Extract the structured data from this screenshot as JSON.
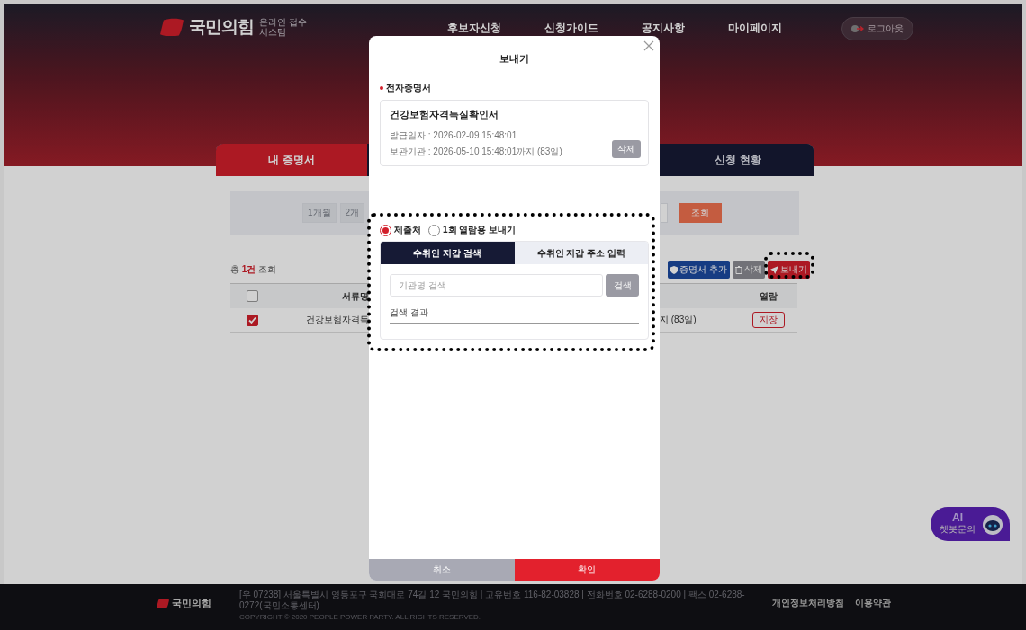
{
  "header": {
    "logo": "국민의힘",
    "logo_sub": [
      "온라인 접수",
      "시스템"
    ],
    "nav": [
      {
        "label": "후보자신청"
      },
      {
        "label": "신청가이드"
      },
      {
        "label": "공지사항"
      },
      {
        "label": "마이페이지"
      }
    ],
    "logout": "로그아웃"
  },
  "tabs": [
    {
      "label": "내 증명서",
      "selected": true
    },
    {
      "label": "신청 현황",
      "selected": false
    }
  ],
  "filter": {
    "periods": [
      "1개월",
      "2개"
    ],
    "search_button": "조회"
  },
  "summary": "총 **1건** 조회",
  "toolbar": [
    {
      "label": "증명서 추가",
      "kind": "add"
    },
    {
      "label": "삭제",
      "kind": "delete"
    },
    {
      "label": "보내기",
      "kind": "send"
    }
  ],
  "table": {
    "header_checked": false,
    "columns": [
      "서류명",
      "열람"
    ],
    "rows": [
      {
        "checked": true,
        "name": "건강보험자격득",
        "period": "지 (83일)",
        "action": "지장"
      }
    ]
  },
  "modal": {
    "title": "보내기",
    "section": "전자증명서",
    "certificate": {
      "name": "건강보험자격득실확인서",
      "issued": "발급일자 : 2026-02-09 15:48:01",
      "retention": "보관기관 : 2026-05-10 15:48:01까지 (83일)",
      "delete": "삭제"
    },
    "recipient_options": [
      {
        "label": "제출처",
        "selected": true
      },
      {
        "label": "1회 열람용 보내기",
        "selected": false
      }
    ],
    "recipient_tabs": [
      {
        "label": "수취인 지갑 검색",
        "selected": true
      },
      {
        "label": "수취인 지갑 주소 입력",
        "selected": false
      }
    ],
    "search": {
      "placeholder": "기관명 검색",
      "button": "검색"
    },
    "results_label": "검색 결과",
    "buttons": [
      {
        "label": "취소",
        "kind": "cancel"
      },
      {
        "label": "확인",
        "kind": "confirm"
      }
    ]
  },
  "chatbot": {
    "title": "AI",
    "label": "챗봇문의"
  },
  "footer": {
    "logo": "국민의힘",
    "address": "[우 07238] 서울특별시 영등포구 국회대로 74길 12 국민의힘 | 고유번호 116-82-03828 | 전화번호 02-6288-0200 | 팩스 02-6288-0272(국민소통센터)",
    "copyright": "COPYRIGHT © 2020 PEOPLE POWER PARTY. ALL RIGHTS RESERVED.",
    "links": [
      "개인정보처리방침",
      "이용약관"
    ]
  }
}
